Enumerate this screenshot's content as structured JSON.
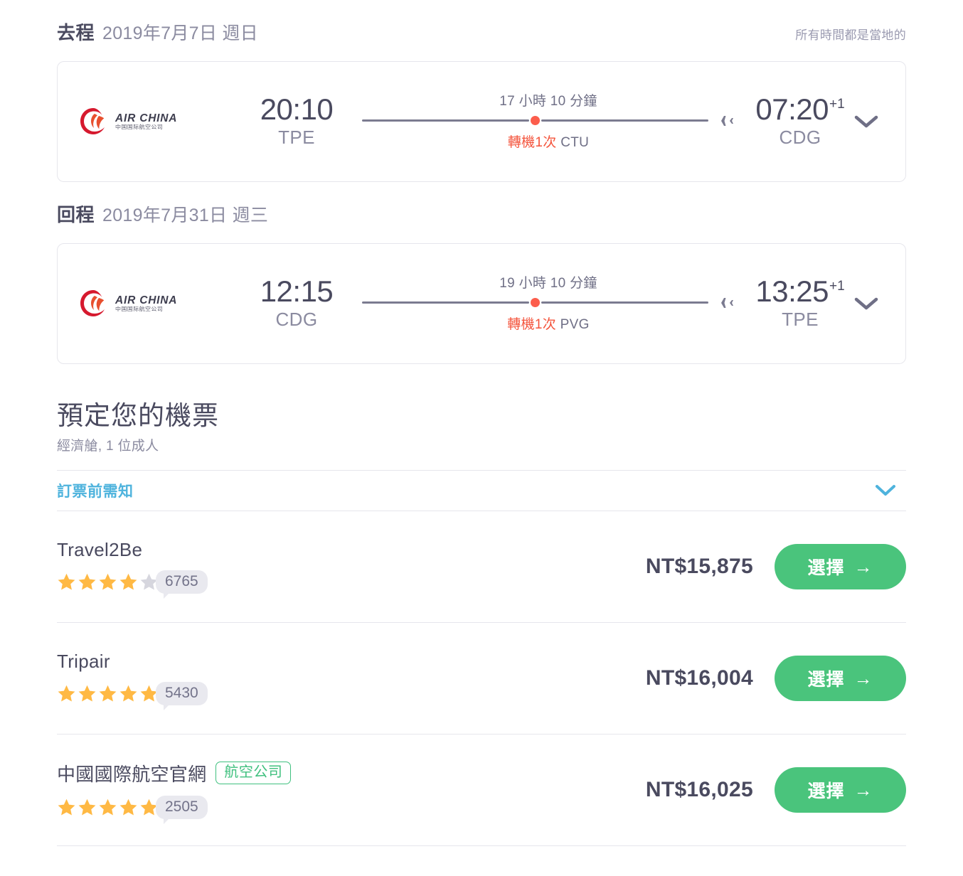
{
  "header": {
    "local_times_note": "所有時間都是當地的"
  },
  "legs": [
    {
      "label": "去程",
      "date": "2019年7月7日 週日",
      "airline": {
        "name": "AIR CHINA",
        "sub": "中国国际航空公司"
      },
      "depart_time": "20:10",
      "depart_airport": "TPE",
      "duration": "17 小時 10 分鐘",
      "stops_count": "轉機1次",
      "stops_code": "CTU",
      "arrive_time": "07:20",
      "arrive_day_offset": "+1",
      "arrive_airport": "CDG"
    },
    {
      "label": "回程",
      "date": "2019年7月31日 週三",
      "airline": {
        "name": "AIR CHINA",
        "sub": "中国国际航空公司"
      },
      "depart_time": "12:15",
      "depart_airport": "CDG",
      "duration": "19 小時 10 分鐘",
      "stops_count": "轉機1次",
      "stops_code": "PVG",
      "arrive_time": "13:25",
      "arrive_day_offset": "+1",
      "arrive_airport": "TPE"
    }
  ],
  "booking": {
    "title": "預定您的機票",
    "subtitle": "經濟艙, 1 位成人",
    "notice_label": "訂票前需知"
  },
  "agencies": [
    {
      "name": "Travel2Be",
      "badge": "",
      "stars_filled": 4,
      "stars_total": 5,
      "review_count": "6765",
      "price": "NT$15,875",
      "select_label": "選擇"
    },
    {
      "name": "Tripair",
      "badge": "",
      "stars_filled": 5,
      "stars_total": 5,
      "review_count": "5430",
      "price": "NT$16,004",
      "select_label": "選擇"
    },
    {
      "name": "中國國際航空官網",
      "badge": "航空公司",
      "stars_filled": 5,
      "stars_total": 5,
      "review_count": "2505",
      "price": "NT$16,025",
      "select_label": "選擇"
    }
  ],
  "colors": {
    "star_filled": "#ffb944",
    "star_empty": "#d6d6de",
    "accent_green": "#4ac47c",
    "accent_blue": "#4eb3dd",
    "stop_red": "#f4543c",
    "text_dark": "#4a4a5f",
    "text_muted": "#8b8ba0"
  },
  "icons": {
    "chevron_down": "chevron-down-icon",
    "plane": "plane-icon",
    "arrow_right": "→"
  }
}
